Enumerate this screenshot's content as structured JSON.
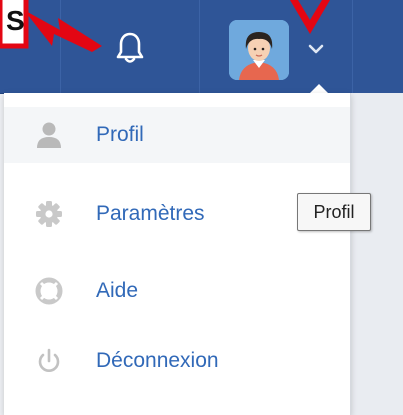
{
  "header": {
    "bell_icon": "bell-icon",
    "avatar_icon": "user-avatar",
    "dropdown_icon": "chevron-down-icon",
    "colors": {
      "bar": "#2f5597",
      "annotation": "#e30613"
    }
  },
  "annotation": {
    "partial_label": "S"
  },
  "menu": {
    "items": [
      {
        "label": "Profil",
        "icon": "user-icon"
      },
      {
        "label": "Paramètres",
        "icon": "gear-icon"
      },
      {
        "label": "Aide",
        "icon": "lifebuoy-icon"
      },
      {
        "label": "Déconnexion",
        "icon": "power-icon"
      }
    ],
    "link_color": "#3169b8"
  },
  "tooltip": {
    "text": "Profil"
  }
}
